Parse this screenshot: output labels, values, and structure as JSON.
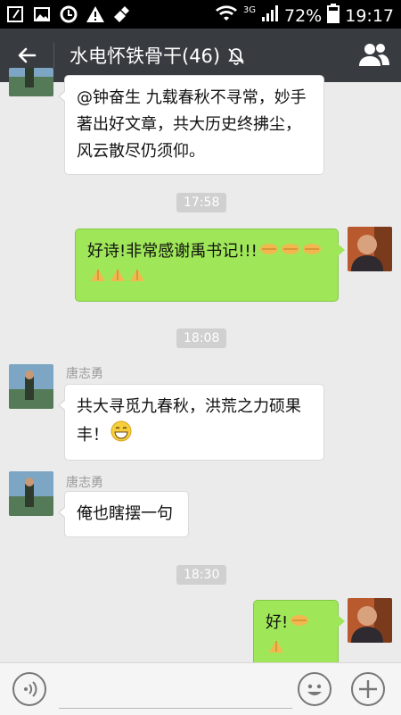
{
  "status_bar": {
    "network": "3G",
    "battery": "72%",
    "time": "19:17"
  },
  "header": {
    "title": "水电怀铁骨干(46)"
  },
  "messages": [
    {
      "type": "incoming",
      "text": "@钟奋生 九载春秋不寻常，妙手著出好文章，共大历史终拂尘，风云散尽仍须仰。"
    },
    {
      "type": "time",
      "text": "17:58"
    },
    {
      "type": "outgoing",
      "text": "好诗!非常感谢禹书记!!!",
      "emojis": [
        "handshake-icon",
        "handshake-icon",
        "handshake-icon",
        "bow-icon",
        "bow-icon",
        "bow-icon"
      ]
    },
    {
      "type": "time",
      "text": "18:08"
    },
    {
      "type": "incoming",
      "sender": "唐志勇",
      "text": "共大寻觅九春秋，洪荒之力硕果丰！",
      "emojis": [
        "grin-icon"
      ]
    },
    {
      "type": "incoming",
      "sender": "唐志勇",
      "text": "俺也瞎摆一句"
    },
    {
      "type": "time",
      "text": "18:30"
    },
    {
      "type": "outgoing",
      "text": "好!",
      "emojis": [
        "handshake-icon",
        "bow-icon"
      ]
    }
  ],
  "colors": {
    "titlebar": "#383b40",
    "background": "#ebebeb",
    "outgoing_bubble": "#9fe758",
    "incoming_bubble": "#ffffff"
  }
}
